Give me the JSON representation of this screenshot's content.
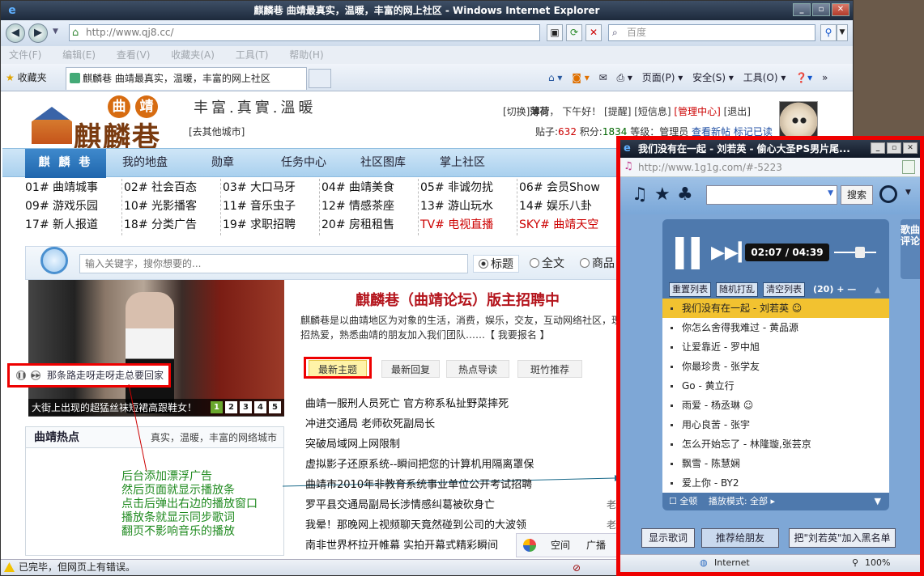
{
  "browser": {
    "title": "麒麟巷 曲靖最真实，温暖，丰富的网上社区 - Windows Internet Explorer",
    "url": "http://www.qj8.cc/",
    "search_placeholder": "百度",
    "menu": [
      "文件(F)",
      "编辑(E)",
      "查看(V)",
      "收藏夹(A)",
      "工具(T)",
      "帮助(H)"
    ],
    "favorites": "收藏夹",
    "tab_title": "麒麟巷 曲靖最真实，温暖，丰富的网上社区",
    "commands": [
      "页面(P) ▾",
      "安全(S) ▾",
      "工具(O) ▾"
    ],
    "status": "已完毕，但网页上有错误。"
  },
  "site": {
    "logo_text": "麒麟巷",
    "logo_q1": "曲",
    "logo_q2": "靖",
    "slogan": "丰富.真實.溫暖",
    "city": "[去其他城市]",
    "user_line_a": "[切换]",
    "user_name": "薄荷",
    "user_line_b": "，  下午好！",
    "user_links": "[提醒] [短信息]",
    "admin_link": "[管理中心]",
    "logout": "[退出]",
    "stats_a": "贴子:",
    "posts": "632",
    "stats_b": "积分:",
    "points": "1834",
    "stats_c": "等级：管理员",
    "new_posts": "查看新帖",
    "mark_read": "标记已读"
  },
  "nav": [
    "麒 麟 巷",
    "我的地盘",
    "勋章",
    "任务中心",
    "社区图库",
    "掌上社区"
  ],
  "categories": [
    [
      "01# 曲靖城事",
      "09# 游戏乐园",
      "17# 新人报道"
    ],
    [
      "02# 社会百态",
      "10# 光影播客",
      "18# 分类广告"
    ],
    [
      "03# 大口马牙",
      "11# 音乐虫子",
      "19# 求职招聘"
    ],
    [
      "04# 曲靖美食",
      "12# 情感茶座",
      "20# 房租租售"
    ],
    [
      "05# 非诚勿扰",
      "13# 游山玩水",
      "TV# 电视直播"
    ],
    [
      "06# 会员Show",
      "14# 娱乐八卦",
      "SKY# 曲靖天空"
    ]
  ],
  "search": {
    "placeholder": "输入关键字，搜你想要的...",
    "opt1": "标题",
    "opt2": "全文",
    "opt3": "商品"
  },
  "photo": {
    "caption": "大街上出现的超猛丝袜短裙高跟鞋女！",
    "pages": [
      "1",
      "2",
      "3",
      "4",
      "5"
    ]
  },
  "float_ad": "那条路走呀走呀走总要回家",
  "hot": {
    "title": "曲靖热点",
    "subtitle": "真实，温暖，丰富的网络城市"
  },
  "annotation": [
    "后台添加漂浮广告",
    "然后页面就显示播放条",
    "点击后弹出右边的播放窗口",
    "播放条就显示同步歌词",
    "翻页不影响音乐的播放"
  ],
  "recruit": {
    "title": "麒麟巷（曲靖论坛）版主招聘中",
    "line1": "麒麟巷是以曲靖地区为对象的生活，消费，娱乐，交友，互动网络社区，现",
    "line2": "招热爱，熟悉曲靖的朋友加入我们团队……【 我要报名 】"
  },
  "tabs": [
    "最新主题",
    "最新回复",
    "热点导读",
    "斑竹推荐"
  ],
  "threads": [
    "曲靖一服刑人员死亡 官方称系私扯野菜摔死",
    "冲进交通局 老师砍死副局长",
    "突破局域网上网限制",
    "虚拟影子还原系统--瞬间把您的计算机用隔离罩保",
    "曲靖市2010年非教育系统事业单位公开考试招聘",
    "罗平县交通局副局长涉情感纠葛被砍身亡",
    "我晕！那晚网上视频聊天竟然碰到公司的大波领",
    "南非世界杯拉开帷幕 实拍开幕式精彩瞬间"
  ],
  "right_col": [
    "老",
    "老"
  ],
  "bottom_tools": [
    "空间",
    "广播"
  ],
  "popup": {
    "title": "我们没有在一起 - 刘若英 - 偷心大圣PS男片尾...",
    "url": "http://www.1g1g.com/#-5223",
    "search_btn": "搜索",
    "time": "02:07 / 04:39",
    "btns": [
      "重置列表",
      "随机打乱",
      "清空列表"
    ],
    "count": "(20)  +  —",
    "songs": [
      "我们没有在一起 - 刘若英 ☺",
      "你怎么舍得我难过 - 黄品源",
      "让爱靠近 - 罗中旭",
      "你最珍贵 - 张学友",
      "Go - 黄立行",
      "雨爱 - 杨丞琳 ☺",
      "用心良苦 - 张宇",
      "怎么开始忘了 - 林隆璇,张芸京",
      "飘雪 - 陈慧娴",
      "爱上你 - BY2"
    ],
    "foot_a": "☐ 全顿",
    "foot_b": "播放模式: 全部 ▸",
    "side_tab": "歌曲评论",
    "show_lyrics": "显示歌词",
    "recommend": "推荐给朋友",
    "blacklist": "把\"刘若英\"加入黑名单",
    "status": "Internet",
    "zoom": "100%"
  }
}
